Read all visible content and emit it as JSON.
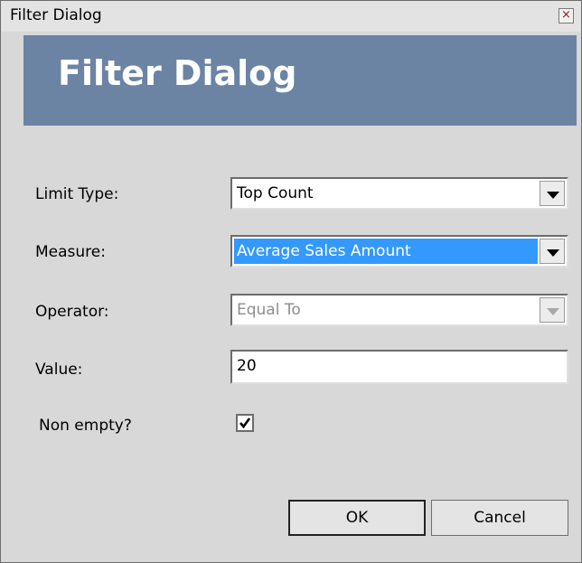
{
  "window": {
    "title": "Filter Dialog",
    "close_glyph": "×"
  },
  "banner": {
    "title": "Filter Dialog",
    "color": "#6b84a4"
  },
  "form": {
    "limit_type": {
      "label": "Limit Type:",
      "value": "Top Count"
    },
    "measure": {
      "label": "Measure:",
      "value": "Average Sales Amount"
    },
    "operator": {
      "label": "Operator:",
      "value": "Equal To",
      "disabled": true
    },
    "value": {
      "label": "Value:",
      "value": "20"
    },
    "non_empty": {
      "label": "Non empty?",
      "checked": true
    }
  },
  "buttons": {
    "ok": "OK",
    "cancel": "Cancel"
  }
}
